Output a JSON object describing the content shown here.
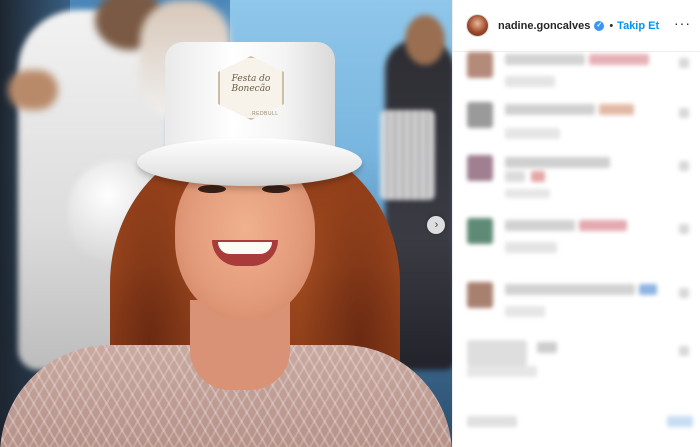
{
  "post": {
    "username": "nadine.goncalves",
    "verified": true,
    "separator": "•",
    "follow_label": "Takip Et",
    "more_label": "···",
    "next_arrow": "›"
  },
  "hat_badge": {
    "line1": "Festa do",
    "line2": "Bonecão",
    "brand": "REDBULL"
  },
  "icons": {
    "verified": "verified-badge-icon",
    "next": "chevron-right-icon",
    "more": "more-options-icon",
    "like": "heart-icon"
  },
  "colors": {
    "follow": "#0095f6",
    "verified": "#3897f0",
    "text": "#262626"
  }
}
